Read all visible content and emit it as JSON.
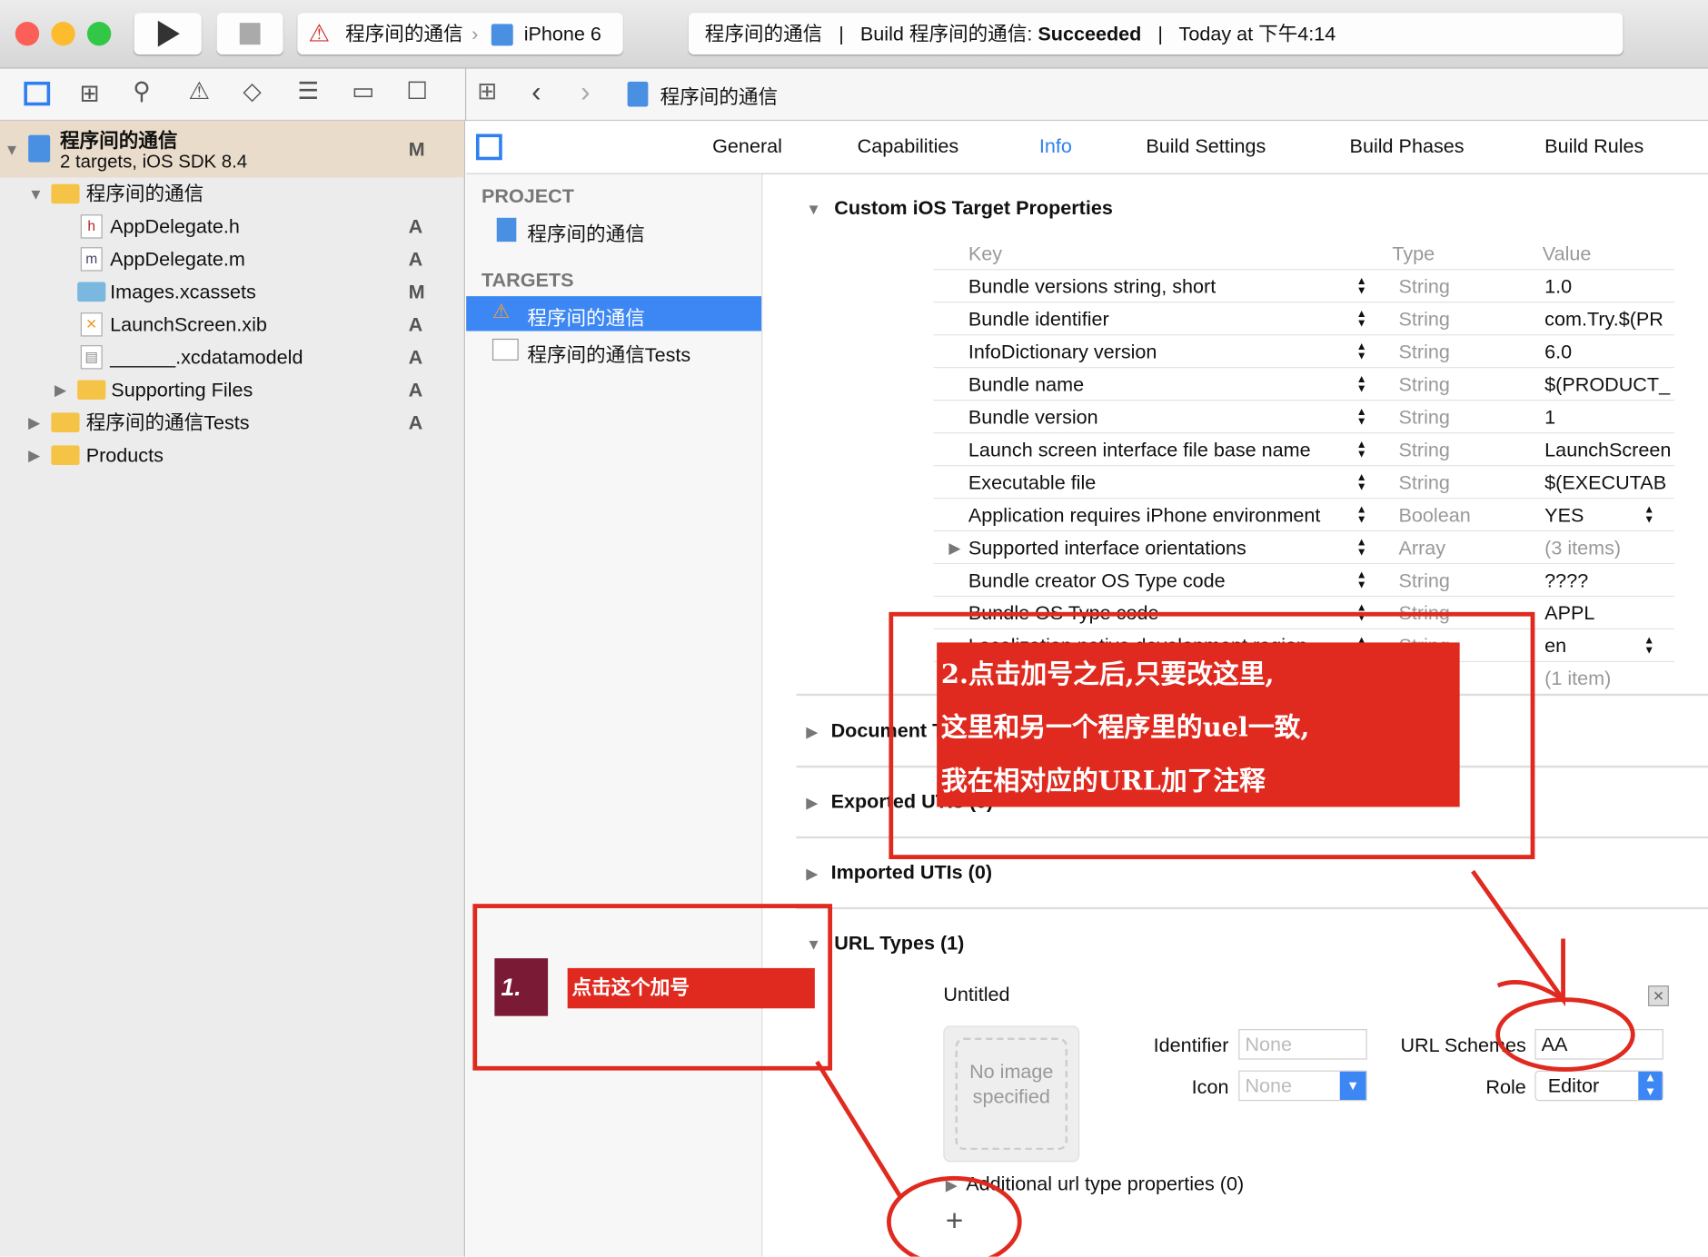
{
  "toolbar": {
    "scheme": "程序间的通信",
    "device": "iPhone 6",
    "status_project": "程序间的通信",
    "status_build": "Build 程序间的通信:",
    "status_result": "Succeeded",
    "status_time": "Today at 下午4:14"
  },
  "jumpbar": {
    "crumb": "程序间的通信"
  },
  "navigator": {
    "project": {
      "name": "程序间的通信",
      "subtitle": "2 targets, iOS SDK 8.4",
      "badge": "M"
    },
    "items": [
      {
        "label": "程序间的通信",
        "badge": "",
        "kind": "folder"
      },
      {
        "label": "AppDelegate.h",
        "badge": "A",
        "kind": "h"
      },
      {
        "label": "AppDelegate.m",
        "badge": "A",
        "kind": "m"
      },
      {
        "label": "Images.xcassets",
        "badge": "M",
        "kind": "assets"
      },
      {
        "label": "LaunchScreen.xib",
        "badge": "A",
        "kind": "xib"
      },
      {
        "label": "______.xcdatamodeld",
        "badge": "A",
        "kind": "model"
      },
      {
        "label": "Supporting Files",
        "badge": "A",
        "kind": "folder"
      },
      {
        "label": "程序间的通信Tests",
        "badge": "A",
        "kind": "folder"
      },
      {
        "label": "Products",
        "badge": "",
        "kind": "folder"
      }
    ]
  },
  "tabs": [
    "General",
    "Capabilities",
    "Info",
    "Build Settings",
    "Build Phases",
    "Build Rules"
  ],
  "active_tab": "Info",
  "targets_panel": {
    "project_header": "PROJECT",
    "project": "程序间的通信",
    "targets_header": "TARGETS",
    "targets": [
      "程序间的通信",
      "程序间的通信Tests"
    ]
  },
  "custom_props": {
    "title": "Custom iOS Target Properties",
    "headers": [
      "Key",
      "Type",
      "Value"
    ],
    "rows": [
      [
        "Bundle versions string, short",
        "String",
        "1.0"
      ],
      [
        "Bundle identifier",
        "String",
        "com.Try.$(PR"
      ],
      [
        "InfoDictionary version",
        "String",
        "6.0"
      ],
      [
        "Bundle name",
        "String",
        "$(PRODUCT_"
      ],
      [
        "Bundle version",
        "String",
        "1"
      ],
      [
        "Launch screen interface file base name",
        "String",
        "LaunchScreen"
      ],
      [
        "Executable file",
        "String",
        "$(EXECUTAB"
      ],
      [
        "Application requires iPhone environment",
        "Boolean",
        "YES"
      ],
      [
        "Supported interface orientations",
        "Array",
        "(3 items)"
      ],
      [
        "Bundle creator OS Type code",
        "String",
        "????"
      ],
      [
        "Bundle OS Type code",
        "String",
        "APPL"
      ],
      [
        "Localization native development region",
        "String",
        "en"
      ],
      [
        "",
        "",
        "(1 item)"
      ]
    ]
  },
  "sections": {
    "documents": "Document Types (0)",
    "exported": "Exported UTIs (0)",
    "imported": "Imported UTIs (0)",
    "url_types": "URL Types (1)"
  },
  "url_type": {
    "name": "Untitled",
    "no_image": "No image specified",
    "identifier_label": "Identifier",
    "identifier_placeholder": "None",
    "icon_label": "Icon",
    "icon_value": "None",
    "schemes_label": "URL Schemes",
    "schemes_value": "AA",
    "role_label": "Role",
    "role_value": "Editor",
    "additional": "Additional url type properties (0)",
    "add": "+"
  },
  "annotations": {
    "step1_number": "1.",
    "step1_text": "点击这个加号",
    "step2_line1": "2.点击加号之后,只要改这里,",
    "step2_line2": "这里和另一个程序里的uel一致,",
    "step2_line3": "我在相对应的URL加了注释",
    "color": "#e02a1f"
  }
}
